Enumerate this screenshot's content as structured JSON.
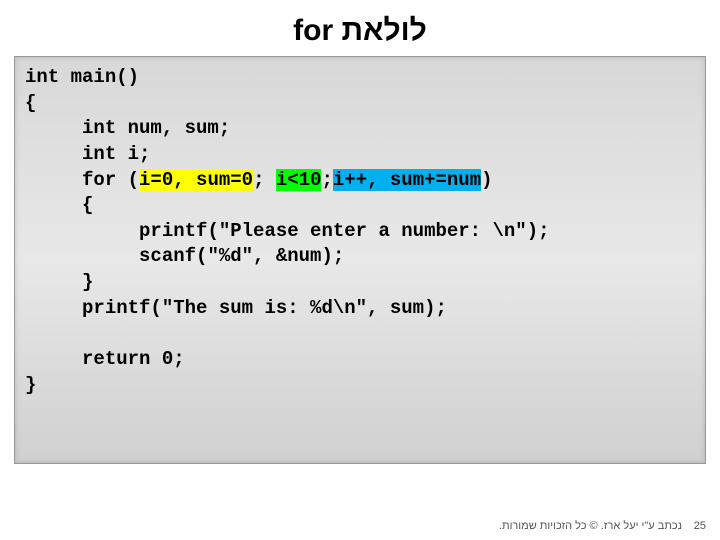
{
  "title": "לולאת for",
  "code": {
    "l1": "int main()",
    "l2": "{",
    "l3_indent": "     ",
    "l3": "int num, sum;",
    "l4_indent": "     ",
    "l4": "int i;",
    "l5_indent": "     ",
    "l5a": "for (",
    "l5b": "i=0, sum=0",
    "l5c": "; ",
    "l5d": "i<10",
    "l5e": ";",
    "l5f": "i++, sum+=num",
    "l5g": ")",
    "l6_indent": "     ",
    "l6": "{",
    "l7_indent": "          ",
    "l7": "printf(\"Please enter a number: \\n\");",
    "l8_indent": "          ",
    "l8": "scanf(\"%d\", &num);",
    "l9_indent": "     ",
    "l9": "}",
    "l10_indent": "     ",
    "l10": "printf(\"The sum is: %d\\n\", sum);",
    "l11": "",
    "l12_indent": "     ",
    "l12": "return 0;",
    "l13": "}"
  },
  "footer": "נכתב ע\"י יעל ארז. © כל הזכויות שמורות.",
  "page_number": "25"
}
